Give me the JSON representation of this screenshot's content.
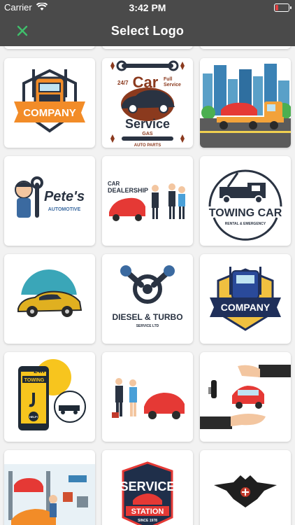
{
  "status_bar": {
    "carrier": "Carrier",
    "time": "3:42 PM"
  },
  "nav": {
    "title": "Select Logo",
    "close_icon": "close-icon"
  },
  "logos": {
    "l1": {
      "text": "COMPANY"
    },
    "l2": {
      "top_left": "24/7",
      "main1": "Car",
      "main2": "Service",
      "top_right1": "Full",
      "top_right2": "Service",
      "sub": "GAS",
      "bottom": "AUTO PARTS"
    },
    "l4": {
      "main": "Pete's",
      "sub": "AUTOMOTIVE"
    },
    "l5": {
      "line1": "CAR",
      "line2": "DEALERSHIP"
    },
    "l6": {
      "main": "TOWING CAR",
      "sub": "RENTAL & EMERGENCY"
    },
    "l8": {
      "main": "DIESEL & TURBO",
      "sub": "SERVICE LTD"
    },
    "l9": {
      "text": "COMPANY"
    },
    "l10": {
      "badge": "24h",
      "label": "TOWING",
      "help": "HELP!"
    },
    "l14": {
      "line1": "SERVICE",
      "line2": "STATION",
      "since": "SINCE 1978"
    }
  },
  "colors": {
    "header_bg": "#4a4a4a",
    "accent_green": "#3fbf6b"
  }
}
